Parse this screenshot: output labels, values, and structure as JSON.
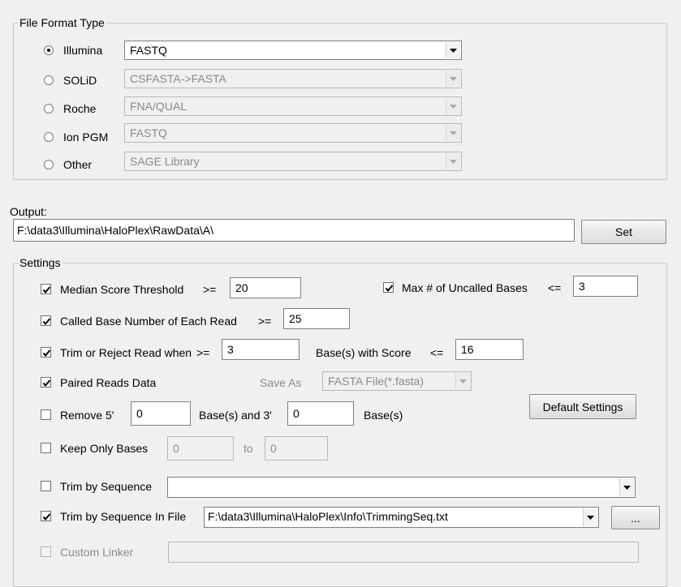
{
  "file_format": {
    "title": "File Format Type",
    "rows": [
      {
        "platform": "Illumina",
        "selected": true,
        "format": "FASTQ",
        "enabled": true
      },
      {
        "platform": "SOLiD",
        "selected": false,
        "format": "CSFASTA->FASTA",
        "enabled": false
      },
      {
        "platform": "Roche",
        "selected": false,
        "format": "FNA/QUAL",
        "enabled": false
      },
      {
        "platform": "Ion PGM",
        "selected": false,
        "format": "FASTQ",
        "enabled": false
      },
      {
        "platform": "Other",
        "selected": false,
        "format": "SAGE Library",
        "enabled": false
      }
    ]
  },
  "output": {
    "label": "Output:",
    "path": "F:\\data3\\Illumina\\HaloPlex\\RawData\\A\\",
    "set_label": "Set"
  },
  "settings": {
    "title": "Settings",
    "median_score": {
      "label": "Median Score Threshold",
      "op": ">=",
      "value": "20",
      "checked": true
    },
    "max_uncalled": {
      "label": "Max # of Uncalled Bases",
      "op": "<=",
      "value": "3",
      "checked": true
    },
    "called_base": {
      "label": "Called Base Number of Each Read",
      "op": ">=",
      "value": "25",
      "checked": true
    },
    "trim_reject": {
      "label": "Trim or Reject Read when",
      "op": ">=",
      "value": "3",
      "mid_label": "Base(s) with Score",
      "op2": "<=",
      "value2": "16",
      "checked": true
    },
    "paired": {
      "label": "Paired Reads Data",
      "save_as_label": "Save As",
      "save_as_value": "FASTA File(*.fasta)",
      "checked": true
    },
    "remove": {
      "label": "Remove 5'",
      "value5": "0",
      "mid_label": "Base(s) and 3'",
      "value3": "0",
      "end_label": "Base(s)",
      "checked": false
    },
    "default_label": "Default Settings",
    "keep_only": {
      "label": "Keep Only Bases",
      "from": "0",
      "to_label": "to",
      "to": "0",
      "checked": false
    },
    "trim_seq": {
      "label": "Trim by Sequence",
      "value": "",
      "checked": false
    },
    "trim_seq_file": {
      "label": "Trim by Sequence In File",
      "value": "F:\\data3\\Illumina\\HaloPlex\\Info\\TrimmingSeq.txt",
      "browse_label": "...",
      "checked": true
    },
    "custom_linker": {
      "label": "Custom Linker",
      "value": "",
      "checked": false
    }
  }
}
